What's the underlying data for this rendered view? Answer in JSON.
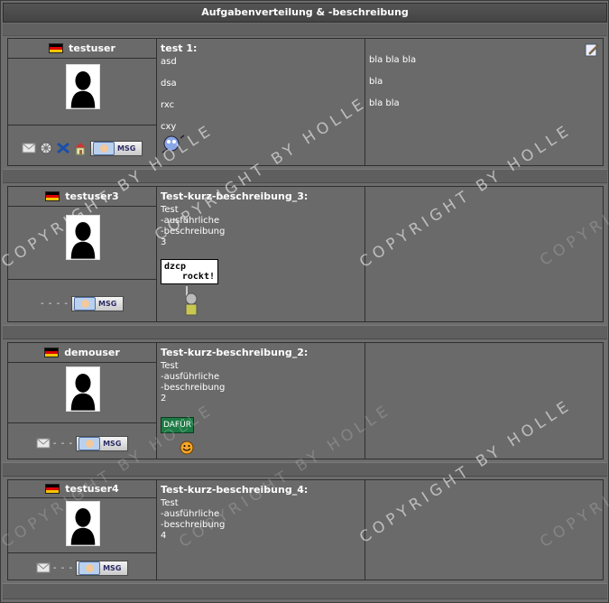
{
  "header": {
    "title": "Aufgabenverteilung & -beschreibung"
  },
  "watermark_text": "COPYRIGHT BY HOLLE",
  "tasks": [
    {
      "user": "testuser",
      "title": "test 1:",
      "lines": [
        "asd",
        "dsa",
        "rxc",
        "cxy"
      ],
      "extra": [
        "bla bla bla",
        "bla",
        "bla bla"
      ],
      "icons": [
        "envelope-icon",
        "icq-icon",
        "msn-icon",
        "home-icon"
      ]
    },
    {
      "user": "testuser3",
      "title": "Test-kurz-beschreibung_3:",
      "lines": [
        "Test",
        "-ausführliche",
        "-beschreibung",
        "3"
      ],
      "dashes": "- - - -",
      "sign": [
        "dzcp",
        "rockt!"
      ]
    },
    {
      "user": "demouser",
      "title": "Test-kurz-beschreibung_2:",
      "lines": [
        "Test",
        "-ausführliche",
        "-beschreibung",
        "2"
      ],
      "dashes": "- - -",
      "sign": [
        "DAFÜR"
      ]
    },
    {
      "user": "testuser4",
      "title": "Test-kurz-beschreibung_4:",
      "lines": [
        "Test",
        "-ausführliche",
        "-beschreibung",
        "4"
      ],
      "dashes": "- - -"
    }
  ],
  "msg_label": "MSG"
}
